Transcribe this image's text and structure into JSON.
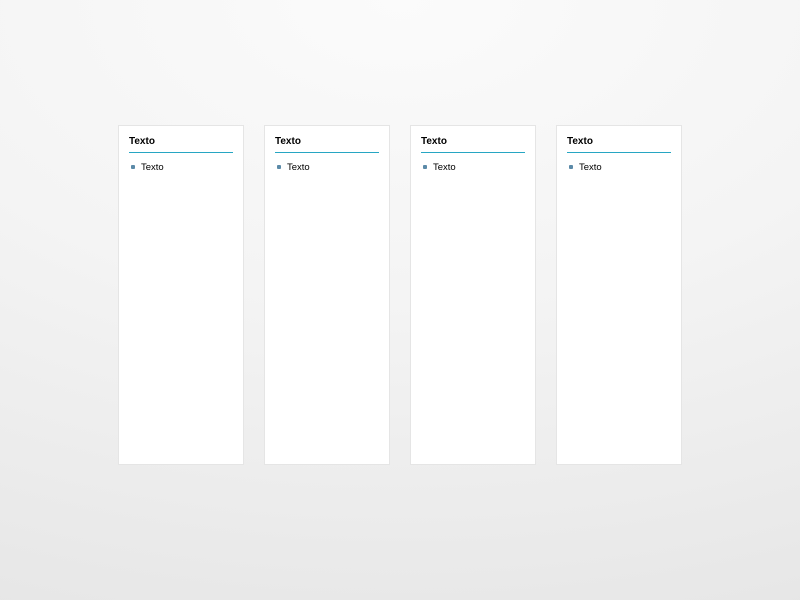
{
  "colors": {
    "accent": "#27a6c3",
    "bullet": "#5b8aa8",
    "card_border": "#e5e5e5",
    "card_bg": "#ffffff"
  },
  "cards": [
    {
      "title": "Texto",
      "items": [
        "Texto"
      ]
    },
    {
      "title": "Texto",
      "items": [
        "Texto"
      ]
    },
    {
      "title": "Texto",
      "items": [
        "Texto"
      ]
    },
    {
      "title": "Texto",
      "items": [
        "Texto"
      ]
    }
  ]
}
